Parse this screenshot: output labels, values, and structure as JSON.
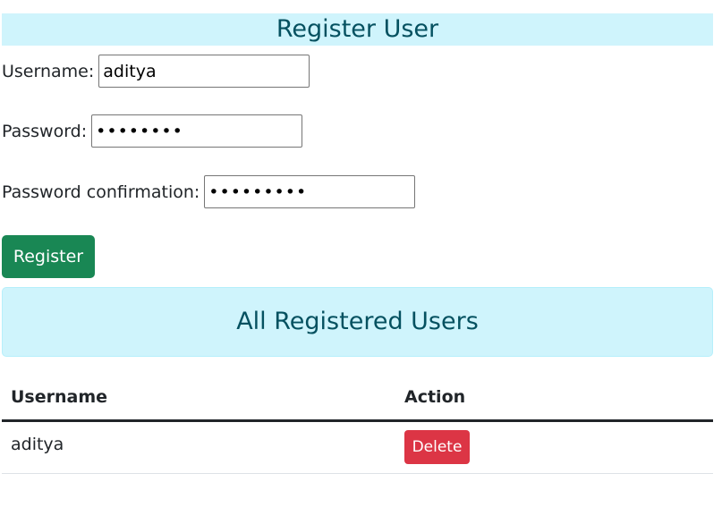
{
  "register": {
    "title": "Register User",
    "username_label": "Username:",
    "username_value": "aditya",
    "password_label": "Password:",
    "password_value": "password",
    "confirm_label": "Password confirmation:",
    "confirm_value": "password1",
    "submit_label": "Register"
  },
  "users": {
    "title": "All Registered Users",
    "columns": [
      "Username",
      "Action"
    ],
    "rows": [
      {
        "username": "aditya",
        "action_label": "Delete"
      }
    ]
  },
  "colors": {
    "info_bg": "#cff4fc",
    "info_text": "#055160",
    "success": "#198754",
    "danger": "#dc3545"
  }
}
